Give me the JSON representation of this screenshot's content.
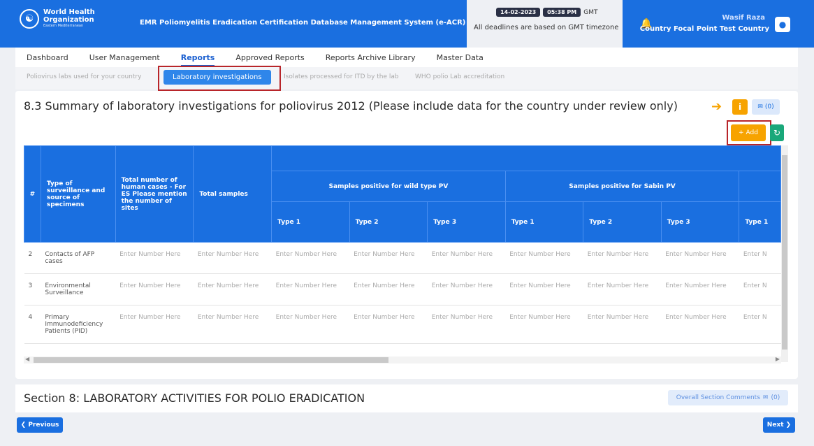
{
  "header": {
    "org_line1": "World Health",
    "org_line2": "Organization",
    "org_sub": "Eastern Mediterranean",
    "app_title": "EMR Poliomyelitis Eradication Certification Database Management System (e-ACR)",
    "date": "14-02-2023",
    "time": "05:38 PM",
    "tz": "GMT",
    "deadline_note": "All deadlines are based on GMT timezone",
    "user_name": "Wasif Raza",
    "user_role": "Country Focal Point Test Country"
  },
  "nav": {
    "items": [
      {
        "label": "Dashboard"
      },
      {
        "label": "User Management"
      },
      {
        "label": "Reports"
      },
      {
        "label": "Approved Reports"
      },
      {
        "label": "Reports Archive Library"
      },
      {
        "label": "Master Data"
      }
    ],
    "active": "Reports"
  },
  "subtabs": [
    {
      "label": "Poliovirus labs used for your country"
    },
    {
      "label": "Laboratory investigations"
    },
    {
      "label": "Isolates processed for ITD by the lab"
    },
    {
      "label": "WHO polio Lab accreditation"
    }
  ],
  "card": {
    "title": "8.3 Summary of laboratory investigations for poliovirus 2012 (Please include data for the country under review only)",
    "comment_count": "(0)",
    "add_label": "Add"
  },
  "table": {
    "col_num": "#",
    "col_type": "Type of surveillance and source of specimens",
    "col_cases": "Total number of human cases - For ES Please mention the number of sites",
    "col_samples": "Total samples",
    "group_wild": "Samples positive for wild type PV",
    "group_sabin": "Samples positive for Sabin PV",
    "sub_type1": "Type 1",
    "sub_type2": "Type 2",
    "sub_type3": "Type 3",
    "placeholder": "Enter Number Here",
    "placeholder_cut": "Enter N",
    "rows": [
      {
        "num": "2",
        "label": "Contacts of AFP cases"
      },
      {
        "num": "3",
        "label": "Environmental Surveillance"
      },
      {
        "num": "4",
        "label": "Primary Immunodeficiency Patients (PID)"
      }
    ]
  },
  "section": {
    "title": "Section 8: LABORATORY ACTIVITIES FOR POLIO ERADICATION",
    "overall_comments": "Overall Section Comments",
    "overall_count": "(0)"
  },
  "footer": {
    "prev": "Previous",
    "next": "Next"
  }
}
